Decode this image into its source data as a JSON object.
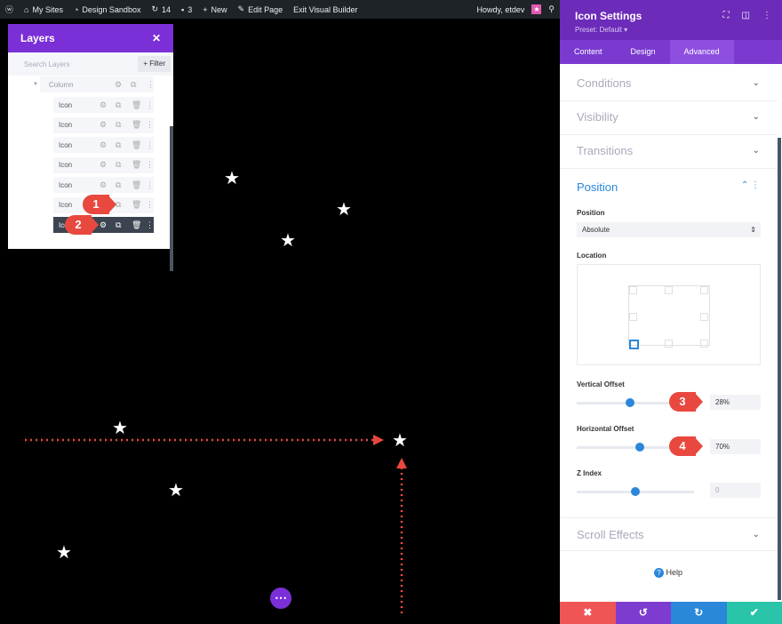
{
  "topbar": {
    "items": [
      {
        "icon": "wordpress-icon",
        "label": ""
      },
      {
        "icon": "sites-icon",
        "label": "My Sites"
      },
      {
        "icon": "dashboard-icon",
        "label": "Design Sandbox"
      },
      {
        "icon": "updates-icon",
        "label": "14"
      },
      {
        "icon": "comment-icon",
        "label": "3"
      },
      {
        "icon": "plus-icon",
        "label": "New"
      },
      {
        "icon": "pencil-icon",
        "label": "Edit Page"
      },
      {
        "icon": "",
        "label": "Exit Visual Builder"
      }
    ],
    "greeting": "Howdy, etdev"
  },
  "layers": {
    "title": "Layers",
    "search_placeholder": "Search Layers",
    "filter": "+ Filter",
    "column": "Column",
    "items": [
      "Icon",
      "Icon",
      "Icon",
      "Icon",
      "Icon",
      "Icon",
      "Icon"
    ]
  },
  "callouts": [
    "1",
    "2",
    "3",
    "4"
  ],
  "settings": {
    "title": "Icon Settings",
    "preset": "Preset: Default ▾",
    "tabs": [
      "Content",
      "Design",
      "Advanced"
    ],
    "active_tab": "Advanced",
    "sections": [
      "Conditions",
      "Visibility",
      "Transitions"
    ],
    "position": {
      "title": "Position",
      "position_label": "Position",
      "position_value": "Absolute",
      "location_label": "Location",
      "location_selected": "bottom-left",
      "vertical_label": "Vertical Offset",
      "vertical_value": "28%",
      "vertical_percent": 28,
      "horizontal_label": "Horizontal Offset",
      "horizontal_value": "70%",
      "horizontal_percent": 70,
      "z_label": "Z Index",
      "z_value": "0"
    },
    "scroll_effects": "Scroll Effects",
    "help": "Help"
  },
  "colors": {
    "purple": "#7b2fd6",
    "accent_blue": "#2b87da",
    "cancel": "#ef5555",
    "undo": "#7e3bd0",
    "redo": "#2b87da",
    "save": "#29c4a9",
    "arrow": "#e8483e"
  }
}
